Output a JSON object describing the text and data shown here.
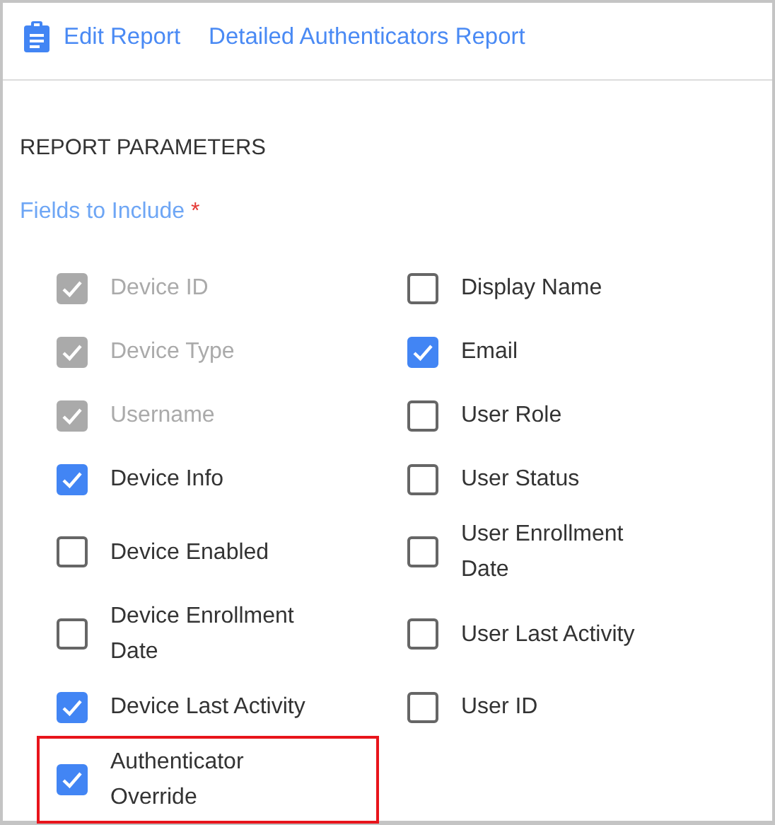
{
  "header": {
    "edit_link": "Edit Report",
    "report_title": "Detailed Authenticators Report"
  },
  "section_title": "REPORT PARAMETERS",
  "fields_label": {
    "text": "Fields to Include",
    "required_mark": "*"
  },
  "field_columns": [
    {
      "fields": [
        {
          "label": "Device ID",
          "checked": true,
          "disabled": true,
          "highlighted": false
        },
        {
          "label": "Device Type",
          "checked": true,
          "disabled": true,
          "highlighted": false
        },
        {
          "label": "Username",
          "checked": true,
          "disabled": true,
          "highlighted": false
        },
        {
          "label": "Device Info",
          "checked": true,
          "disabled": false,
          "highlighted": false
        },
        {
          "label": "Device Enabled",
          "checked": false,
          "disabled": false,
          "highlighted": false
        },
        {
          "label": "Device Enrollment Date",
          "checked": false,
          "disabled": false,
          "highlighted": false
        },
        {
          "label": "Device Last Activity",
          "checked": true,
          "disabled": false,
          "highlighted": false
        },
        {
          "label": "Authenticator Override",
          "checked": true,
          "disabled": false,
          "highlighted": true
        }
      ]
    },
    {
      "fields": [
        {
          "label": "Display Name",
          "checked": false,
          "disabled": false,
          "highlighted": false
        },
        {
          "label": "Email",
          "checked": true,
          "disabled": false,
          "highlighted": false
        },
        {
          "label": "User Role",
          "checked": false,
          "disabled": false,
          "highlighted": false
        },
        {
          "label": "User Status",
          "checked": false,
          "disabled": false,
          "highlighted": false
        },
        {
          "label": "User Enrollment Date",
          "checked": false,
          "disabled": false,
          "highlighted": false
        },
        {
          "label": "User Last Activity",
          "checked": false,
          "disabled": false,
          "highlighted": false
        },
        {
          "label": "User ID",
          "checked": false,
          "disabled": false,
          "highlighted": false
        }
      ]
    }
  ]
}
